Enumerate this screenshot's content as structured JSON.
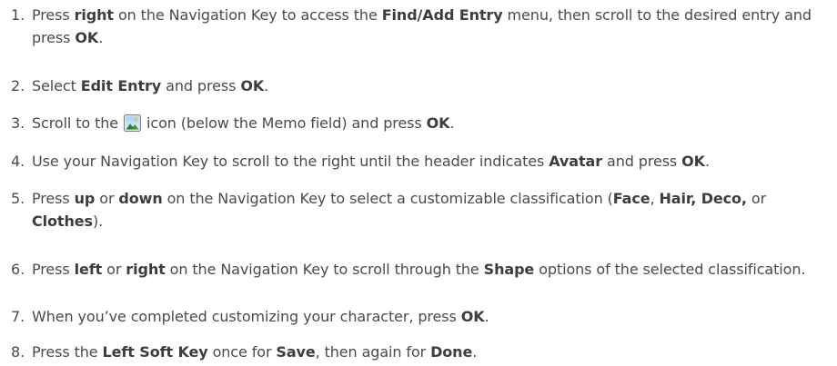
{
  "steps": [
    {
      "number": "1.",
      "parts": [
        "Press ",
        "right",
        " on the Navigation Key to access the ",
        "Find/Add Entry",
        " menu, then scroll to the desired entry and press ",
        "OK",
        "."
      ]
    },
    {
      "number": "2.",
      "parts": [
        "Select ",
        "Edit Entry",
        " and press ",
        "OK",
        "."
      ]
    },
    {
      "number": "3.",
      "before_icon": "Scroll to the ",
      "icon": "picture-icon",
      "parts": [
        " icon (below the Memo field) and press ",
        "OK",
        "."
      ]
    },
    {
      "number": "4.",
      "parts": [
        "Use your Navigation Key to scroll to the right until the header indicates ",
        "Avatar",
        " and press ",
        "OK",
        "."
      ]
    },
    {
      "number": "5.",
      "parts": [
        "Press ",
        "up",
        " or ",
        "down",
        " on the Navigation Key to select a customizable classification (",
        "Face",
        ", ",
        "Hair, Deco,",
        " or ",
        "Clothes",
        ")."
      ]
    },
    {
      "number": "6.",
      "parts": [
        "Press ",
        "left",
        " or ",
        "right",
        " on the Navigation Key to scroll through the ",
        "Shape",
        " options of the selected classification."
      ]
    },
    {
      "number": "7.",
      "parts": [
        "When you’ve completed customizing your character, press ",
        "OK",
        "."
      ]
    },
    {
      "number": "8.",
      "parts": [
        "Press the ",
        "Left Soft Key",
        " once for ",
        "Save",
        ", then again for ",
        "Done",
        "."
      ]
    }
  ]
}
